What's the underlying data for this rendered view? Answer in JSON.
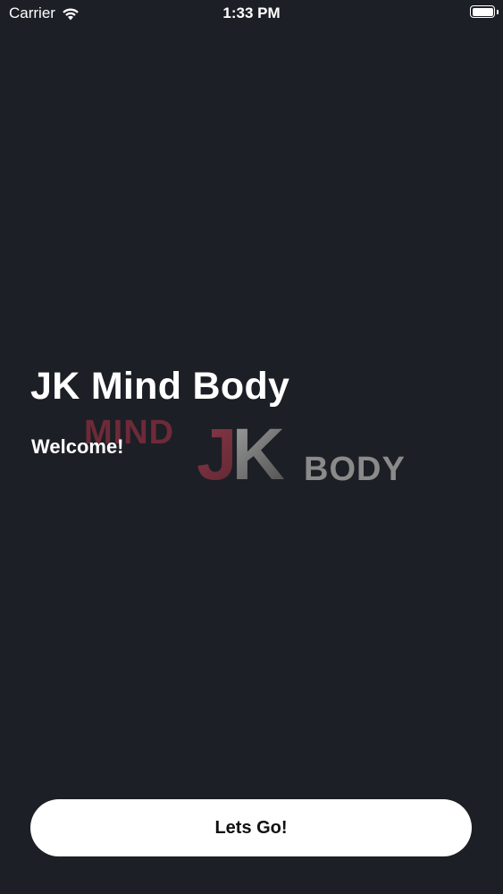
{
  "status_bar": {
    "carrier": "Carrier",
    "time": "1:33 PM",
    "icons": [
      "wifi-icon",
      "battery-icon"
    ]
  },
  "main": {
    "title": "JK Mind Body",
    "subtitle": "Welcome!",
    "logo": {
      "text_mind": "MIND",
      "text_jk": "JK",
      "text_body": "BODY"
    }
  },
  "actions": {
    "primary_button_label": "Lets Go!"
  },
  "colors": {
    "background": "#1c1f25",
    "text": "#ffffff",
    "button_background": "#ffffff",
    "button_text": "#111111",
    "logo_accent": "#6e2a38",
    "logo_gray": "#8a8a8a"
  }
}
